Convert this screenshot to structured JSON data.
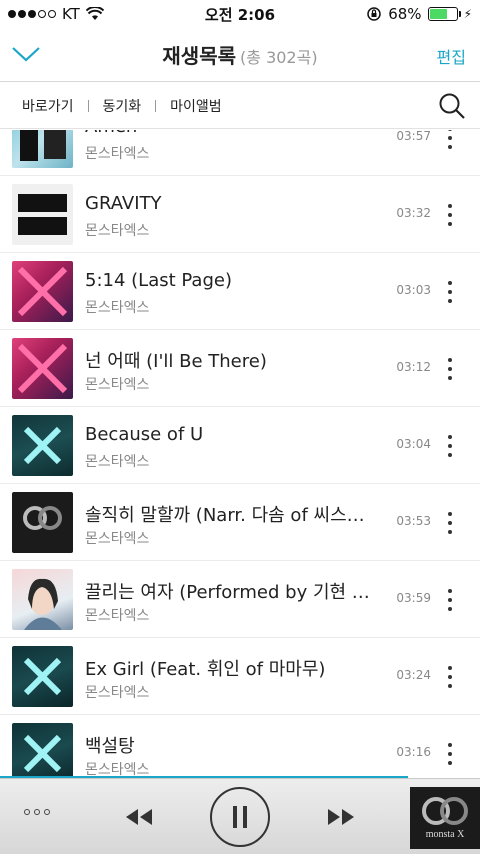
{
  "status_bar": {
    "carrier": "KT",
    "time": "오전 2:06",
    "battery": "68%",
    "battery_level": 0.68
  },
  "header": {
    "title": "재생목록",
    "count": "(총 302곡)",
    "edit_label": "편집"
  },
  "subnav": {
    "items": [
      "바로가기",
      "동기화",
      "마이앨범"
    ]
  },
  "songs": [
    {
      "title": "Amen",
      "artist": "몬스타엑스",
      "duration": "03:57",
      "art": "art-a",
      "art_text": "MONSTA"
    },
    {
      "title": "GRAVITY",
      "artist": "몬스타엑스",
      "duration": "03:32",
      "art": "art-b",
      "art_text": "MON STA X"
    },
    {
      "title": "5:14 (Last Page)",
      "artist": "몬스타엑스",
      "duration": "03:03",
      "art": "art-c",
      "art_text": ""
    },
    {
      "title": "넌 어때 (I'll Be There)",
      "artist": "몬스타엑스",
      "duration": "03:12",
      "art": "art-c",
      "art_text": ""
    },
    {
      "title": "Because of U",
      "artist": "몬스타엑스",
      "duration": "03:04",
      "art": "art-d",
      "art_text": "MONSTA X"
    },
    {
      "title": "솔직히 말할까 (Narr. 다솜 of 씨스타...",
      "artist": "몬스타엑스",
      "duration": "03:53",
      "art": "art-e",
      "art_text": "monsta X"
    },
    {
      "title": "끌리는 여자 (Performed by 기현 &...",
      "artist": "몬스타엑스",
      "duration": "03:59",
      "art": "art-f",
      "art_text": ""
    },
    {
      "title": "Ex Girl (Feat. 휘인 of 마마무)",
      "artist": "몬스타엑스",
      "duration": "03:24",
      "art": "art-g",
      "art_text": "MONSTA X"
    },
    {
      "title": "백설탕",
      "artist": "몬스타엑스",
      "duration": "03:16",
      "art": "art-g",
      "art_text": "MONSTA X"
    }
  ],
  "player": {
    "now_playing_art_text": "monsta X",
    "progress": 0.85
  },
  "colors": {
    "accent": "#1aa6c8",
    "battery_green": "#4cd964"
  },
  "icons": {
    "back": "chevron-down-icon",
    "search": "search-icon",
    "more": "more-vertical-icon",
    "prev": "rewind-icon",
    "pause": "pause-icon",
    "next": "fast-forward-icon",
    "menu": "more-horizontal-icon"
  }
}
